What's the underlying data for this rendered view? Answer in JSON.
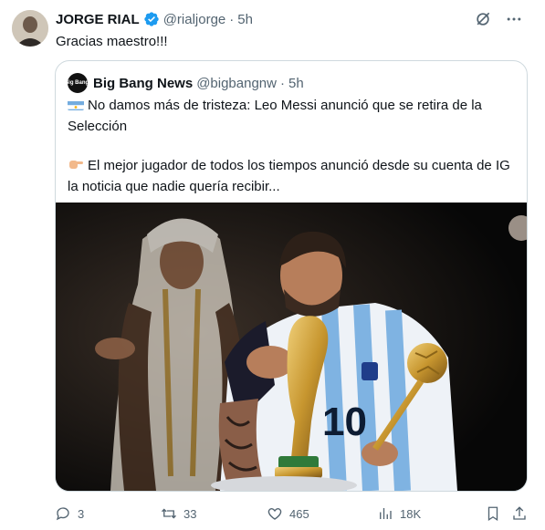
{
  "tweet": {
    "author_name": "JORGE RIAL",
    "handle": "@rialjorge",
    "separator": "·",
    "time": "5h",
    "text": "Gracias maestro!!!"
  },
  "quote": {
    "logo_text": "Big Bang!",
    "author_name": "Big Bang News",
    "handle": "@bigbangnw",
    "separator": "·",
    "time": "5h",
    "line1": "No damos más de tristeza: Leo Messi anunció que se retira de la Selección",
    "line2": "El mejor jugador de todos los tiempos anunció desde su cuenta de IG la noticia que nadie quería recibir...",
    "photo_jersey_number": "10"
  },
  "actions": {
    "replies": "3",
    "retweets": "33",
    "likes": "465",
    "views": "18K"
  },
  "colors": {
    "text": "#0f1419",
    "secondary": "#536471",
    "verified": "#1d9bf0",
    "border": "#cfd9de"
  }
}
